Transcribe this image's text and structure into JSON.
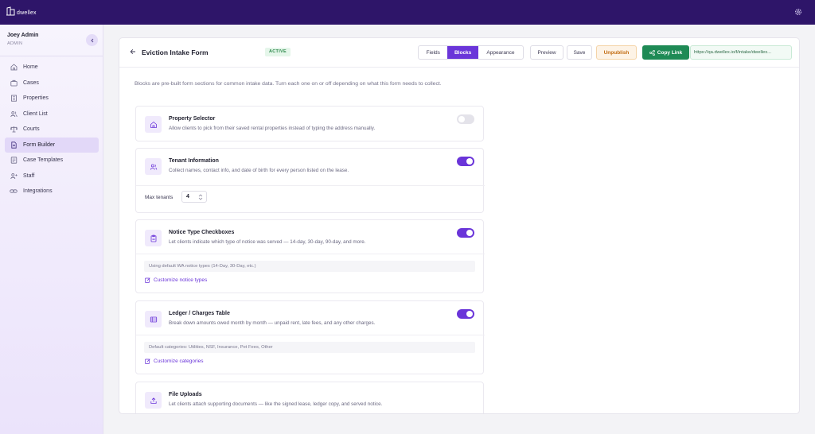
{
  "app": {
    "logo_text": "dwellex"
  },
  "user": {
    "name": "Joey Admin",
    "role": "ADMIN"
  },
  "nav": [
    {
      "label": "Home",
      "icon": "home-icon"
    },
    {
      "label": "Cases",
      "icon": "briefcase-icon"
    },
    {
      "label": "Properties",
      "icon": "building-icon"
    },
    {
      "label": "Client List",
      "icon": "users-icon"
    },
    {
      "label": "Courts",
      "icon": "scale-icon"
    },
    {
      "label": "Form Builder",
      "icon": "document-icon",
      "active": true
    },
    {
      "label": "Case Templates",
      "icon": "template-icon"
    },
    {
      "label": "Staff",
      "icon": "staff-icon"
    },
    {
      "label": "Integrations",
      "icon": "link-icon"
    }
  ],
  "header": {
    "title": "Eviction Intake Form",
    "status": "ACTIVE",
    "tabs": [
      "Fields",
      "Blocks",
      "Appearance"
    ],
    "active_tab": "Blocks",
    "preview_label": "Preview",
    "save_label": "Save",
    "unpublish_label": "Unpublish",
    "copy_link_label": "Copy Link",
    "link_url": "https://qa.dwellex.io/f/intake/dwellex..."
  },
  "intro": "Blocks are pre-built form sections for common intake data. Turn each one on or off depending on what this form needs to collect.",
  "blocks": [
    {
      "title": "Property Selector",
      "description": "Allow clients to pick from their saved rental properties instead of typing the address manually.",
      "enabled": false
    },
    {
      "title": "Tenant Information",
      "description": "Collect names, contact info, and date of birth for every person listed on the lease.",
      "enabled": true,
      "max_label": "Max tenants",
      "max_value": "4"
    },
    {
      "title": "Notice Type Checkboxes",
      "description": "Let clients indicate which type of notice was served — 14-day, 30-day, 90-day, and more.",
      "enabled": true,
      "info": "Using default WA notice types (14-Day, 30-Day, etc.)",
      "link": "Customize notice types"
    },
    {
      "title": "Ledger / Charges Table",
      "description": "Break down amounts owed month by month — unpaid rent, late fees, and any other charges.",
      "enabled": true,
      "info": "Default categories: Utilities, NSF, Insurance, Pet Fees, Other",
      "link": "Customize categories"
    },
    {
      "title": "File Uploads",
      "description": "Let clients attach supporting documents — like the signed lease, ledger copy, and served notice."
    }
  ],
  "colors": {
    "topbar": "#2e1569",
    "accent": "#6a35d9",
    "success": "#1e8a55",
    "warning": "#c26c12"
  }
}
